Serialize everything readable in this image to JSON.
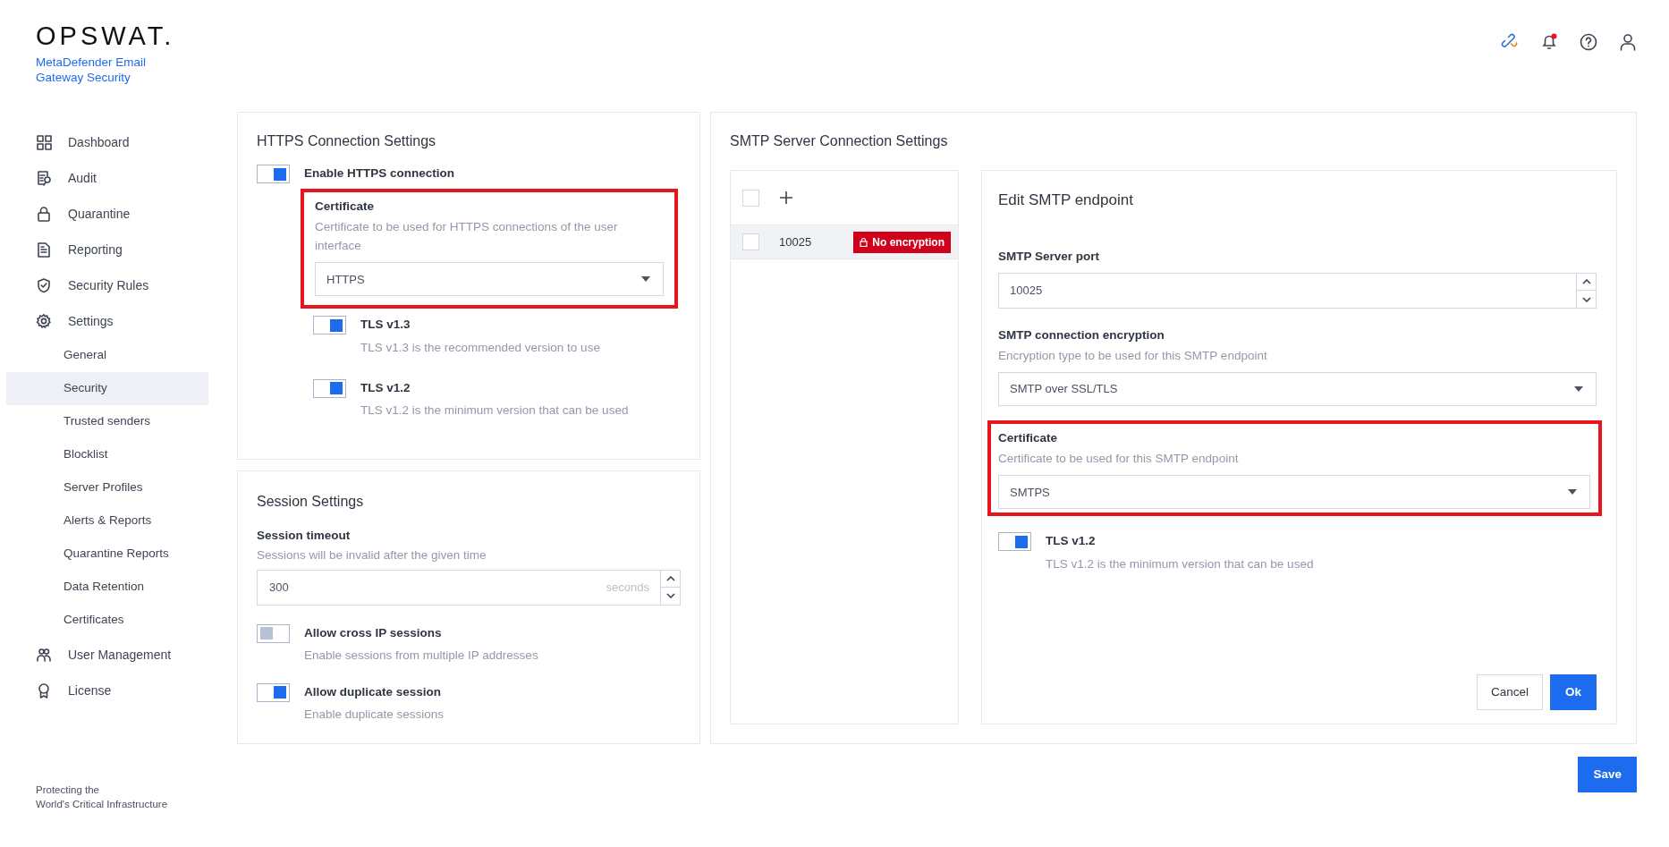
{
  "brand": {
    "logo": "OPSWAT.",
    "product_lines": [
      "MetaDefender Email",
      "Gateway Security"
    ],
    "tagline_lines": [
      "Protecting the",
      "World's Critical Infrastructure"
    ]
  },
  "header": {
    "notifications_unread": true
  },
  "sidebar": {
    "items": [
      {
        "label": "Dashboard",
        "selected": false
      },
      {
        "label": "Audit",
        "selected": false
      },
      {
        "label": "Quarantine",
        "selected": false
      },
      {
        "label": "Reporting",
        "selected": false
      },
      {
        "label": "Security Rules",
        "selected": false
      },
      {
        "label": "Settings",
        "selected": false,
        "children": [
          {
            "label": "General",
            "selected": false
          },
          {
            "label": "Security",
            "selected": true
          },
          {
            "label": "Trusted senders",
            "selected": false
          },
          {
            "label": "Blocklist",
            "selected": false
          },
          {
            "label": "Server Profiles",
            "selected": false
          },
          {
            "label": "Alerts & Reports",
            "selected": false
          },
          {
            "label": "Quarantine Reports",
            "selected": false
          },
          {
            "label": "Data Retention",
            "selected": false
          },
          {
            "label": "Certificates",
            "selected": false
          }
        ]
      },
      {
        "label": "User Management",
        "selected": false
      },
      {
        "label": "License",
        "selected": false
      }
    ]
  },
  "https": {
    "title": "HTTPS Connection Settings",
    "enable": {
      "label": "Enable HTTPS connection",
      "on": true
    },
    "certificate": {
      "label": "Certificate",
      "hint": "Certificate to be used for HTTPS connections of the user interface",
      "value": "HTTPS",
      "highlighted": true
    },
    "tls": [
      {
        "label": "TLS v1.3",
        "hint": "TLS v1.3 is the recommended version to use",
        "on": true
      },
      {
        "label": "TLS v1.2",
        "hint": "TLS v1.2 is the minimum version that can be used",
        "on": true
      }
    ]
  },
  "session": {
    "title": "Session Settings",
    "timeout": {
      "label": "Session timeout",
      "hint": "Sessions will be invalid after the given time",
      "value": "300",
      "unit": "seconds"
    },
    "toggles": [
      {
        "label": "Allow cross IP sessions",
        "hint": "Enable sessions from multiple IP addresses",
        "on": false
      },
      {
        "label": "Allow duplicate session",
        "hint": "Enable duplicate sessions",
        "on": true
      }
    ]
  },
  "smtp": {
    "title": "SMTP Server Connection Settings",
    "list": {
      "select_all_checked": false,
      "rows": [
        {
          "port": "10025",
          "badge": "No encryption",
          "checked": false,
          "selected": true
        }
      ]
    },
    "edit": {
      "title": "Edit SMTP endpoint",
      "port": {
        "label": "SMTP Server port",
        "value": "10025"
      },
      "encryption": {
        "label": "SMTP connection encryption",
        "hint": "Encryption type to be used for this SMTP endpoint",
        "value": "SMTP over SSL/TLS"
      },
      "certificate": {
        "label": "Certificate",
        "hint": "Certificate to be used for this SMTP endpoint",
        "value": "SMTPS",
        "highlighted": true
      },
      "tls": {
        "label": "TLS v1.2",
        "hint": "TLS v1.2 is the minimum version that can be used",
        "on": true
      },
      "buttons": [
        {
          "label": "Cancel",
          "kind": "secondary"
        },
        {
          "label": "Ok",
          "kind": "primary"
        }
      ]
    }
  },
  "save_button": "Save"
}
